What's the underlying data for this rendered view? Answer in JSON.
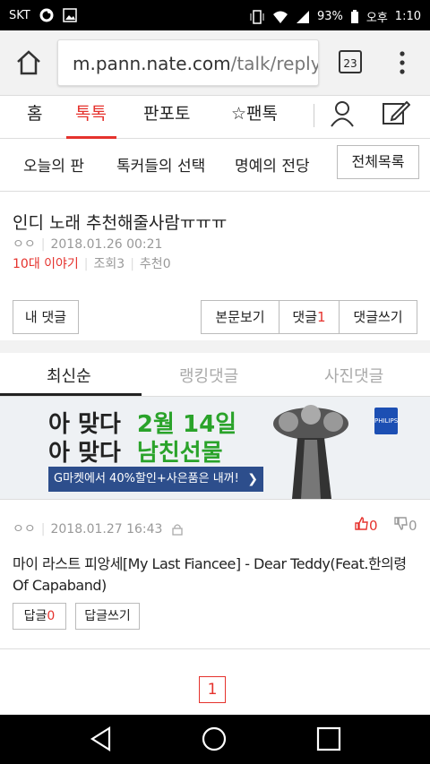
{
  "status": {
    "carrier": "SKT",
    "battery": "93%",
    "period": "오후",
    "time": "1:10"
  },
  "browser": {
    "url_domain": "m.pann.nate.com",
    "url_path": "/talk/reply",
    "tab_count": "23"
  },
  "gnb": {
    "home": "홈",
    "talk": "톡톡",
    "panpo": "판포토",
    "fantalk": "팬톡"
  },
  "subnav": {
    "today": "오늘의 판",
    "choice": "톡커들의 선택",
    "fame": "명예의 전당",
    "all": "전체목록"
  },
  "post": {
    "title": "인디 노래 추천해줄사람ㅠㅠㅠ",
    "author": "ㅇㅇ",
    "date": "2018.01.26 00:21",
    "category": "10대 이야기",
    "views_label": "조회",
    "views": "3",
    "recommend_label": "추천",
    "recommend": "0"
  },
  "buttons": {
    "my_comments": "내 댓글",
    "view_post": "본문보기",
    "comments_label": "댓글",
    "comments_count": "1",
    "write_comment": "댓글쓰기"
  },
  "tabs": {
    "latest": "최신순",
    "ranking": "랭킹댓글",
    "photo": "사진댓글"
  },
  "ad": {
    "line1_a": "아 맞다",
    "line1_b": "2월 14일",
    "line2_a": "아 맞다",
    "line2_b": "남친선물",
    "bar": "G마켓에서 40%할인+사은품은 내꺼!",
    "brand": "PHILIPS"
  },
  "comment": {
    "author": "ㅇㅇ",
    "date": "2018.01.27 16:43",
    "likes": "0",
    "dislikes": "0",
    "text": "마이 라스트 피앙세[My Last Fiancee] - Dear Teddy(Feat.한의령 Of Capaband)",
    "reply_label": "답글",
    "reply_count": "0",
    "write_reply": "답글쓰기"
  },
  "pagination": {
    "current": "1"
  },
  "colors": {
    "accent": "#e5322d",
    "ad_green": "#2aa32a",
    "ad_blue": "#2d4e8c"
  }
}
